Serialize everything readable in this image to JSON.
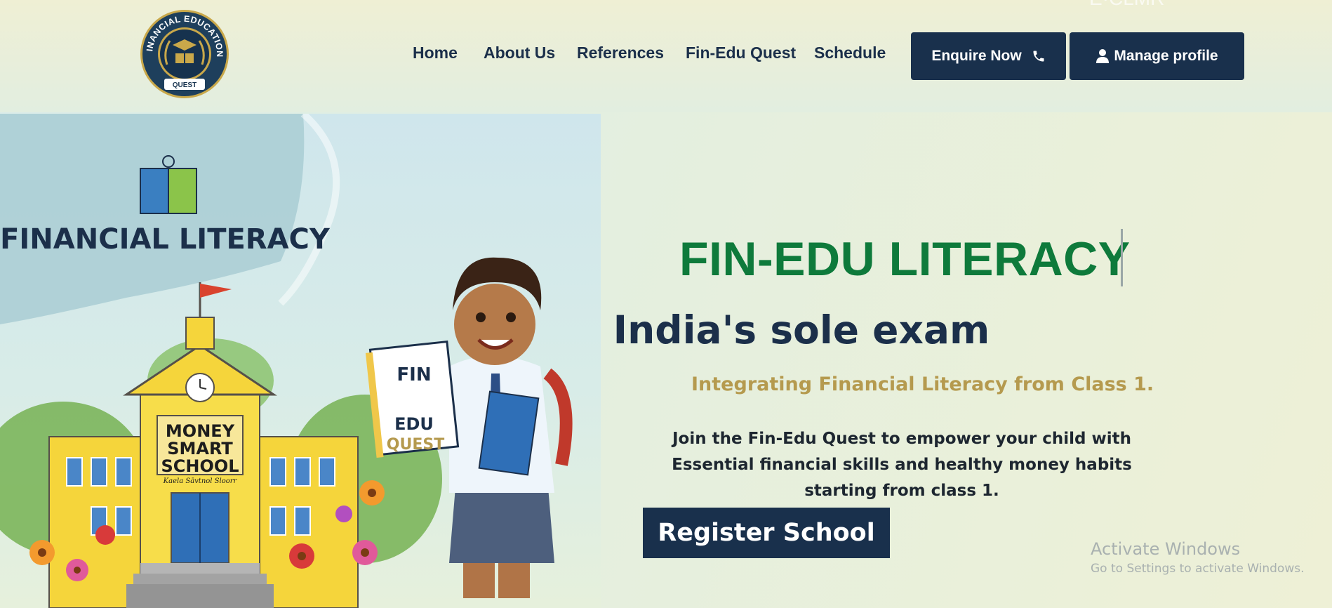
{
  "header": {
    "logo": {
      "ring_text": "FINANCIAL EDUCATION",
      "ribbon_text": "QUEST",
      "colors": {
        "ring": "#1e3f5c",
        "gold": "#c9a84a",
        "inner": "#16324e"
      }
    },
    "top_ghost_text": "E·CLMR",
    "nav": [
      "Home",
      "About Us",
      "References",
      "Fin-Edu Quest",
      "Schedule"
    ],
    "enquire_label": "Enquire Now",
    "enquire_icon": "phone-icon",
    "manage_label": "Manage profile",
    "manage_icon": "user-icon"
  },
  "hero": {
    "art": {
      "badge_title": "FINANCIAL LITERACY",
      "school_sign": [
        "MONEY",
        "SMART",
        "SCHOOL"
      ],
      "school_sign_small": "Kaela Sāvtnol Sloorr",
      "book_words": [
        "FIN",
        "EDU",
        "QUEST"
      ]
    },
    "title": "FIN-EDU LITERACY",
    "subtitle": "India's sole exam",
    "tagline": "Integrating Financial Literacy from Class 1.",
    "description": "Join the Fin-Edu Quest to empower your child with Essential financial skills and healthy money habits starting from class 1.",
    "cta_label": "Register School"
  },
  "watermark": {
    "line1": "Activate Windows",
    "line2": "Go to Settings to activate Windows."
  },
  "colors": {
    "navy": "#19304c",
    "green": "#0e7a3b",
    "gold": "#b59a4e"
  }
}
